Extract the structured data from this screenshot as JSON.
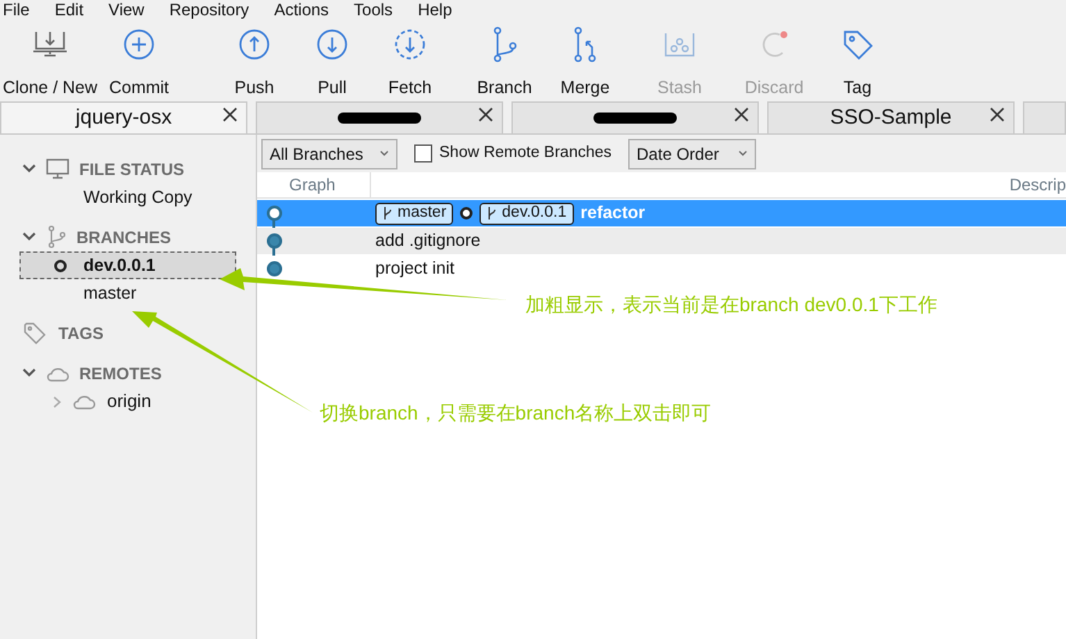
{
  "menu": [
    "File",
    "Edit",
    "View",
    "Repository",
    "Actions",
    "Tools",
    "Help"
  ],
  "toolbar": [
    {
      "label": "Clone / New",
      "disabled": false
    },
    {
      "label": "Commit",
      "disabled": false
    },
    {
      "label": "Push",
      "disabled": false
    },
    {
      "label": "Pull",
      "disabled": false
    },
    {
      "label": "Fetch",
      "disabled": false
    },
    {
      "label": "Branch",
      "disabled": false
    },
    {
      "label": "Merge",
      "disabled": false
    },
    {
      "label": "Stash",
      "disabled": true
    },
    {
      "label": "Discard",
      "disabled": true
    },
    {
      "label": "Tag",
      "disabled": false
    }
  ],
  "tabs": [
    {
      "label": "jquery-osx",
      "selected": true
    },
    {
      "selected": false
    },
    {
      "selected": false
    },
    {
      "label": "SSO-Sample",
      "selected": false
    }
  ],
  "sidebar": [
    {
      "title": "FILE STATUS",
      "kind": "status",
      "expanded": true,
      "items": [
        {
          "label": "Working Copy"
        }
      ]
    },
    {
      "title": "BRANCHES",
      "kind": "branches",
      "expanded": true,
      "items": [
        {
          "label": "dev.0.0.1",
          "current": true,
          "selected": true
        },
        {
          "label": "master",
          "current": false,
          "selected": false
        }
      ]
    },
    {
      "title": "TAGS",
      "kind": "tags"
    },
    {
      "title": "REMOTES",
      "kind": "remotes",
      "expanded": true,
      "items": [
        {
          "label": "origin",
          "expanded": false
        }
      ]
    }
  ],
  "filters": {
    "branches": "All Branches",
    "remote_checkbox": {
      "label": "Show Remote Branches",
      "checked": false
    },
    "order": "Date Order"
  },
  "columns": [
    "Graph",
    "Descrip"
  ],
  "commits": [
    {
      "refs": [
        {
          "name": "master",
          "current": false
        },
        {
          "name": "dev.0.0.1",
          "current": true
        }
      ],
      "message": "refactor",
      "selected": true
    },
    {
      "message": "add .gitignore",
      "selected": false
    },
    {
      "message": "project init",
      "selected": false
    }
  ],
  "annotations": [
    "加粗显示，表示当前是在branch dev0.0.1下工作",
    "切换branch，只需要在branch名称上双击即可"
  ]
}
